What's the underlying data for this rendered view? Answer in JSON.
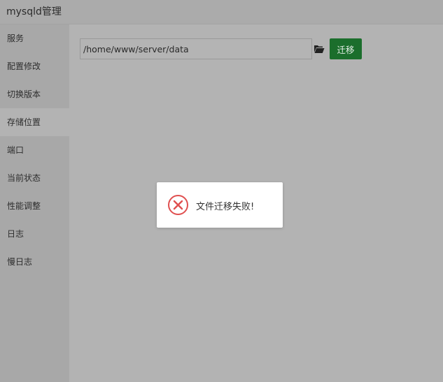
{
  "window": {
    "title": "mysqld管理"
  },
  "sidebar": {
    "items": [
      {
        "label": "服务"
      },
      {
        "label": "配置修改"
      },
      {
        "label": "切换版本"
      },
      {
        "label": "存储位置"
      },
      {
        "label": "端口"
      },
      {
        "label": "当前状态"
      },
      {
        "label": "性能调整"
      },
      {
        "label": "日志"
      },
      {
        "label": "慢日志"
      }
    ],
    "active_index": 3
  },
  "storage": {
    "path_value": "/home/www/server/data",
    "folder_icon": "folder-open-icon",
    "migrate_label": "迁移",
    "migrate_color": "#1b6e2c"
  },
  "toast": {
    "icon": "error-circle-icon",
    "icon_color": "#e05050",
    "message": "文件迁移失败!"
  }
}
